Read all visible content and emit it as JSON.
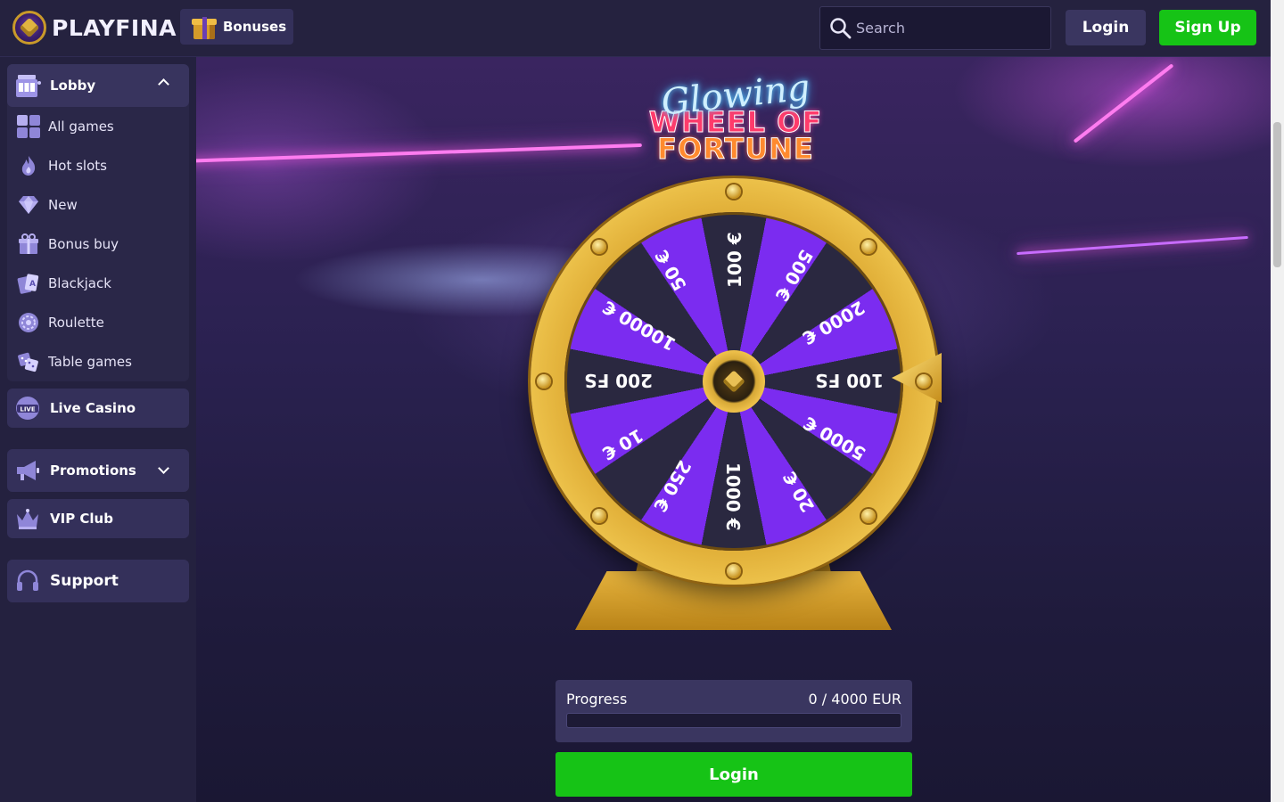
{
  "header": {
    "brand": "PLAYFINA",
    "bonuses_label": "Bonuses",
    "search_placeholder": "Search",
    "login_label": "Login",
    "signup_label": "Sign Up"
  },
  "sidebar": {
    "lobby_label": "Lobby",
    "items": [
      {
        "label": "All games",
        "icon": "grid-icon"
      },
      {
        "label": "Hot slots",
        "icon": "flame-icon"
      },
      {
        "label": "New",
        "icon": "diamond-icon"
      },
      {
        "label": "Bonus buy",
        "icon": "gift-icon"
      },
      {
        "label": "Blackjack",
        "icon": "cards-icon"
      },
      {
        "label": "Roulette",
        "icon": "roulette-icon"
      },
      {
        "label": "Table games",
        "icon": "dice-icon"
      }
    ],
    "live_casino_label": "Live Casino",
    "promotions_label": "Promotions",
    "vip_label": "VIP Club",
    "support_label": "Support"
  },
  "main": {
    "title_script": "Glowing",
    "title_line1": "WHEEL OF",
    "title_line2": "FORTUNE",
    "wheel_segments": [
      "100 €",
      "500 €",
      "2000 €",
      "100 FS",
      "5000 €",
      "20 €",
      "1000 €",
      "250 €",
      "10 €",
      "200 FS",
      "10000 €",
      "50 €"
    ],
    "progress_label": "Progress",
    "progress_value": "0 / 4000 EUR",
    "progress_fraction": 0,
    "login_label": "Login"
  },
  "colors": {
    "accent_green": "#16c316",
    "segment_purple": "#7b2cf0",
    "segment_dark": "#2a2840",
    "gold": "#e2b13a"
  }
}
